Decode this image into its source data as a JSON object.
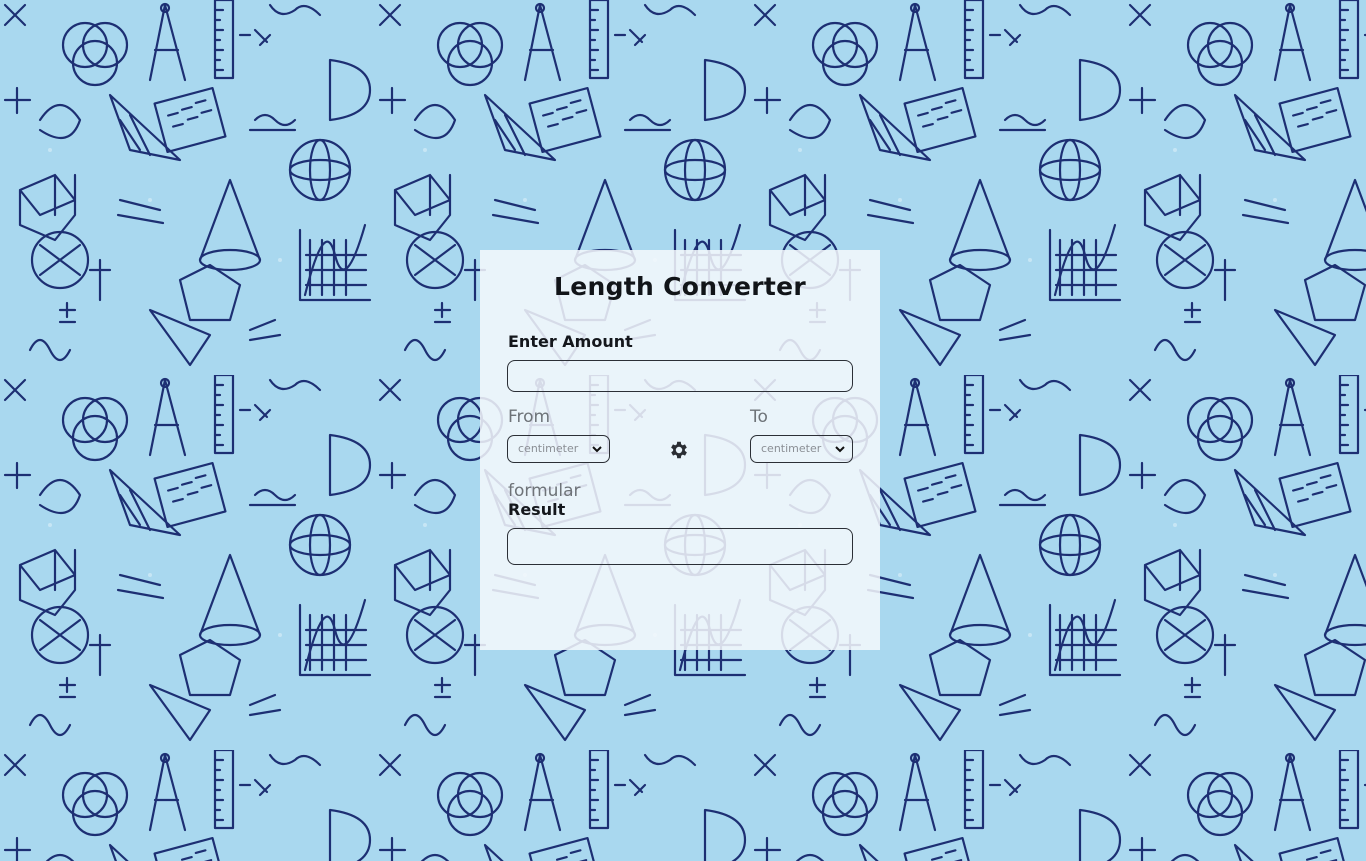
{
  "converter": {
    "title": "Length Converter",
    "amount_label": "Enter Amount",
    "amount_value": "",
    "from_label": "From",
    "to_label": "To",
    "from_unit": "centimeter",
    "to_unit": "centimeter",
    "swap_icon": "gear-icon",
    "formula_label": "formular",
    "result_label": "Result",
    "result_value": ""
  },
  "colors": {
    "background": "#a9d8ef",
    "doodle_ink": "#1d2f73",
    "card": "#f4f8fc",
    "border": "#2b2f36"
  }
}
